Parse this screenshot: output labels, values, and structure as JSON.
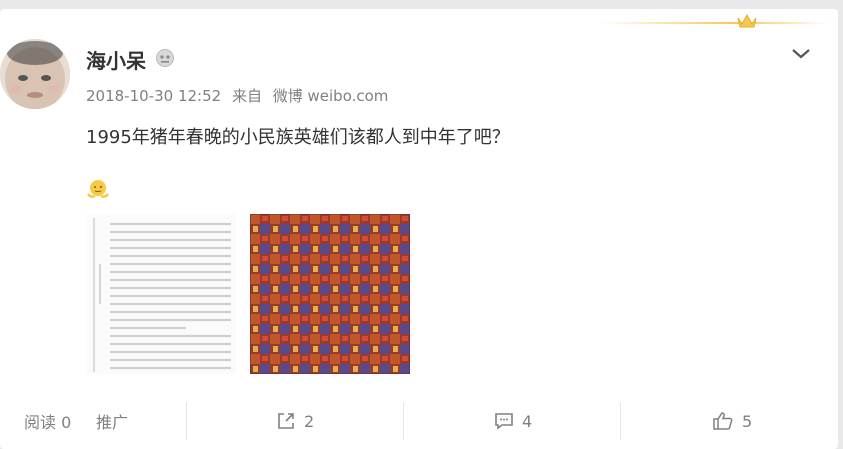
{
  "post": {
    "username": "海小呆",
    "date": "2018-10-30 12:52",
    "source_prefix": "来自",
    "source": "微博 weibo.com",
    "text": "1995年猪年春晚的小民族英雄们该都人到中年了吧？",
    "emoji_icon": "shrug-emoji-icon"
  },
  "footer": {
    "read_label": "阅读 0",
    "promote_label": "推广",
    "repost_count": "2",
    "comment_count": "4",
    "like_count": "5"
  },
  "colors": {
    "accent_gold": "#f5c850",
    "meta_gray": "#808080",
    "text": "#333333"
  }
}
